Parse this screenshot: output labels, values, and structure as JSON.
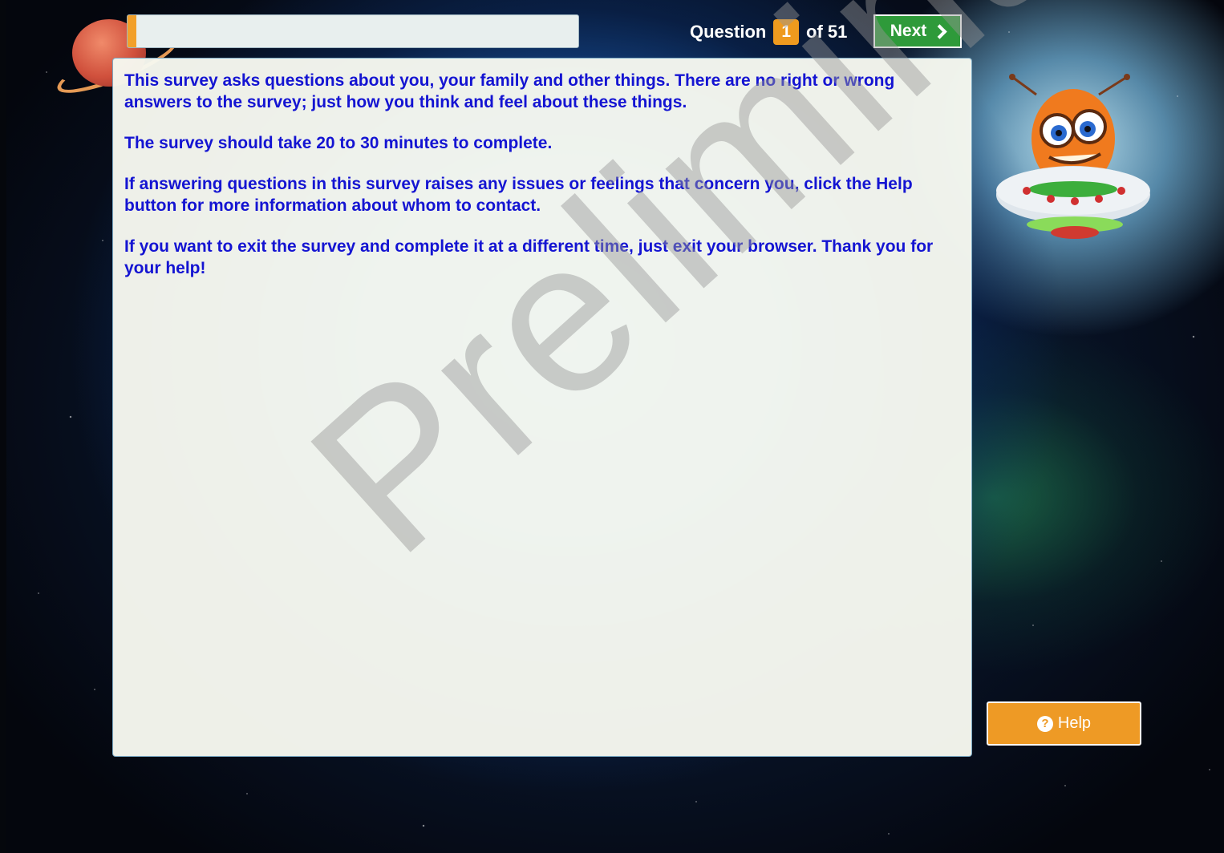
{
  "progress": {
    "fraction": 0.02,
    "fill_color": "#f2a02a"
  },
  "header": {
    "question_label": "Question",
    "current_question": "1",
    "total_label": "of 51",
    "next_label": "Next",
    "next_icon": "chevron-right-icon"
  },
  "content": {
    "paragraphs": [
      "This survey asks questions about you, your family and other things. There are no right or wrong answers to the survey; just how you think and feel about these things.",
      "The survey should take 20 to 30 minutes to complete.",
      "If answering questions in this survey raises any issues or feelings that concern you, click the Help button for more information about whom to contact.",
      "If you want to exit the survey and complete it at a different time, just exit your browser. Thank you for your help!"
    ],
    "text_color": "#1414d2"
  },
  "help": {
    "label": "Help",
    "icon": "question-circle-icon",
    "color": "#ee9a25"
  },
  "next_color": "#2e9a3a",
  "watermark": "Preliminary"
}
